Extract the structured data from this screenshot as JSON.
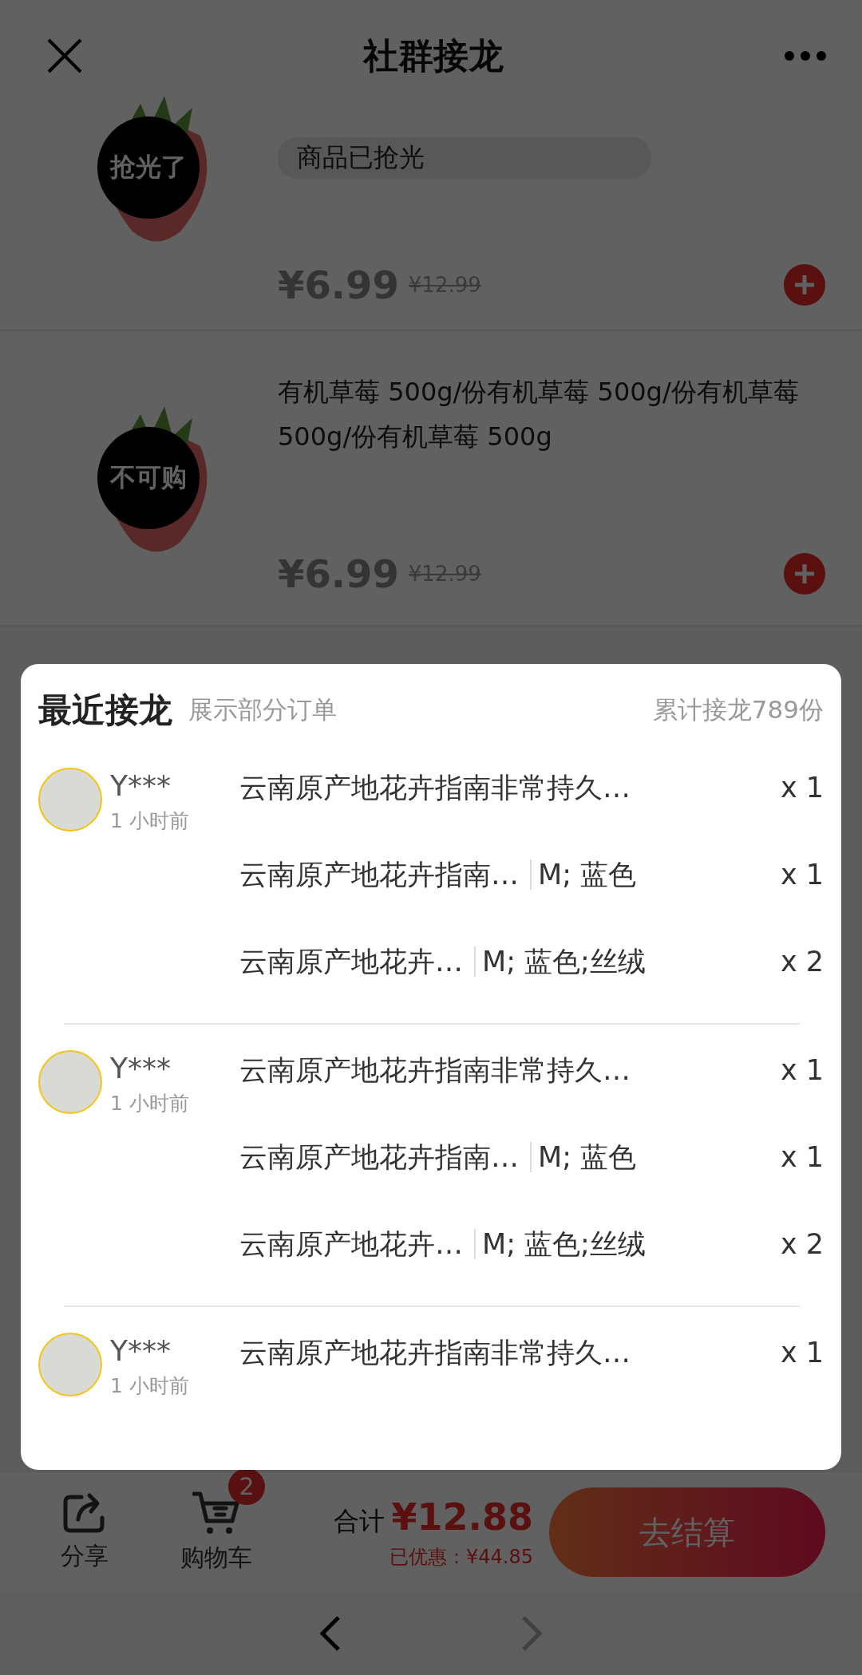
{
  "nav_bar": {
    "title": "社群接龙"
  },
  "products": [
    {
      "badge": "抢光了",
      "tag": "商品已抢光",
      "price": "¥6.99",
      "original_price": "¥12.99"
    },
    {
      "title": "有机草莓 500g/份有机草莓 500g/份有机草莓 500g/份有机草莓 500g",
      "badge": "不可购",
      "price": "¥6.99",
      "original_price": "¥12.99"
    }
  ],
  "recent_orders": {
    "title": "最近接龙",
    "subtitle": "展示部分订单",
    "total_count": "累计接龙789份",
    "orders": [
      {
        "name": "Y***",
        "time": "1 小时前",
        "items": [
          {
            "title": "云南原产地花卉指南非常持久…",
            "quantity": "x 1"
          },
          {
            "title": "云南原产地花卉指南…",
            "spec": "M; 蓝色",
            "quantity": "x 1"
          },
          {
            "title": "云南原产地花卉…",
            "spec": "M; 蓝色;丝绒",
            "quantity": "x 2"
          }
        ]
      },
      {
        "name": "Y***",
        "time": "1 小时前",
        "items": [
          {
            "title": "云南原产地花卉指南非常持久…",
            "quantity": "x 1"
          },
          {
            "title": "云南原产地花卉指南…",
            "spec": "M; 蓝色",
            "quantity": "x 1"
          },
          {
            "title": "云南原产地花卉…",
            "spec": "M; 蓝色;丝绒",
            "quantity": "x 2"
          }
        ]
      },
      {
        "name": "Y***",
        "time": "1 小时前",
        "items": [
          {
            "title": "云南原产地花卉指南非常持久…",
            "quantity": "x 1"
          }
        ]
      }
    ]
  },
  "bottom_bar": {
    "share_label": "分享",
    "cart_label": "购物车",
    "cart_count": "2",
    "total_label": "合计",
    "total": "¥12.88",
    "discount": "已优惠：¥44.85",
    "checkout": "去结算"
  },
  "browser_nav": [
    {
      "kind": "back",
      "disabled": false
    },
    {
      "kind": "forward",
      "disabled": true
    }
  ]
}
